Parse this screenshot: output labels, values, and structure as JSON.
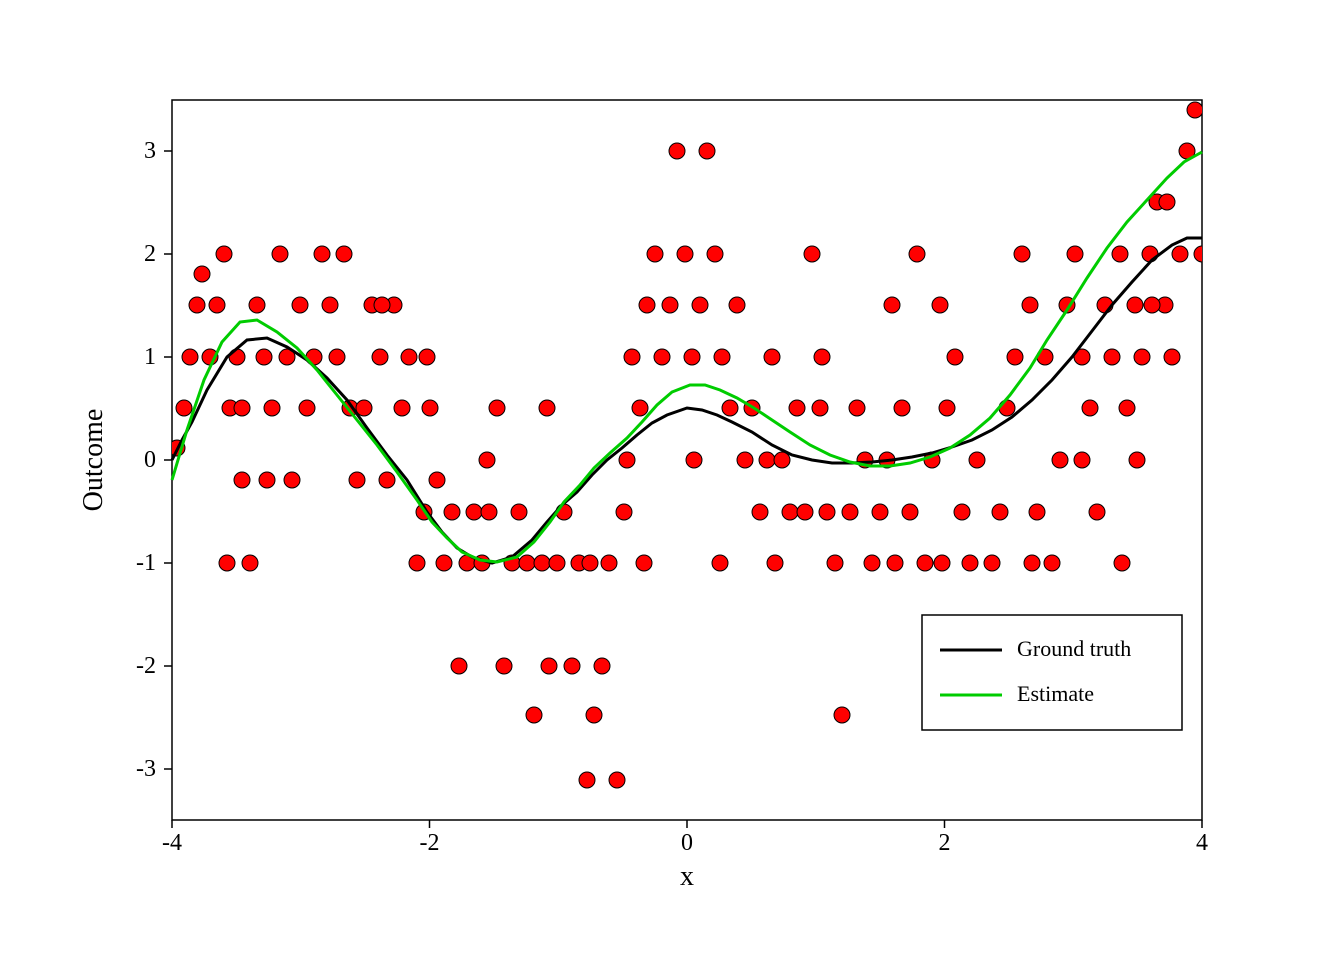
{
  "chart": {
    "title": "",
    "x_label": "x",
    "y_label": "Outcome",
    "x_axis": [
      -4,
      -2,
      0,
      2,
      4
    ],
    "y_axis": [
      -3,
      -2,
      -1,
      0,
      1,
      2,
      3
    ],
    "legend": {
      "ground_truth_label": "Ground truth",
      "estimate_label": "Estimate",
      "ground_truth_color": "#000000",
      "estimate_color": "#00cc00"
    },
    "colors": {
      "dot_fill": "#ff0000",
      "dot_stroke": "#000000",
      "axis_color": "#000000",
      "grid_color": "#cccccc",
      "background": "#ffffff",
      "plot_border": "#000000"
    }
  }
}
